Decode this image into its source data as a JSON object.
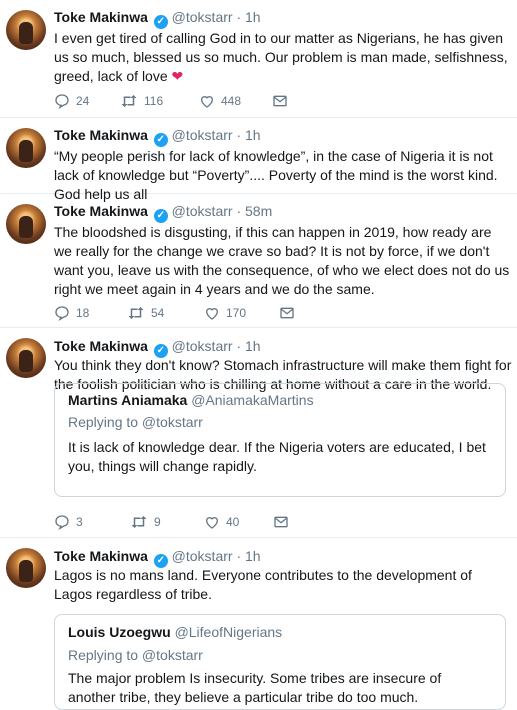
{
  "colors": {
    "accent": "#1da1f2",
    "muted": "#657786",
    "text": "#14171a",
    "border": "#e6ecf0",
    "heart": "#e0245e"
  },
  "tweets": [
    {
      "name": "Toke Makinwa",
      "handle": "@tokstarr",
      "sep": "·",
      "time": "1h",
      "text": "I even get tired of calling God in to our matter as Nigerians, he has given us so much, blessed us so much. Our problem is man made, selfishness, greed, lack of love",
      "emoji": "❤",
      "replies": "24",
      "retweets": "116",
      "likes": "448"
    },
    {
      "name": "Toke Makinwa",
      "handle": "@tokstarr",
      "sep": "·",
      "time": "1h",
      "text": "“My people perish for lack of knowledge”, in the case of Nigeria it is not lack of knowledge but “Poverty”.... Poverty of the mind is the worst kind. God help us all"
    },
    {
      "name": "Toke Makinwa",
      "handle": "@tokstarr",
      "sep": "·",
      "time": "58m",
      "text": "The bloodshed is disgusting, if this can happen in 2019, how ready are we really for the change we crave so bad? It is not by force, if we don't want you, leave us with the consequence, of who we elect does not do us right we meet again in 4 years and we do the same.",
      "replies": "18",
      "retweets": "54",
      "likes": "170"
    },
    {
      "name": "Toke Makinwa",
      "handle": "@tokstarr",
      "sep": "·",
      "time": "1h",
      "text": "You think they don't know? Stomach infrastructure will make them fight for the foolish politician who is chilling at home without a care in the world.",
      "quote": {
        "name": "Martins Aniamaka",
        "handle": "@AniamakaMartins",
        "replying": "Replying to @tokstarr",
        "text": "It is lack of knowledge dear. If the Nigeria voters are educated, I bet you, things will change rapidly."
      },
      "replies": "3",
      "retweets": "9",
      "likes": "40"
    },
    {
      "name": "Toke Makinwa",
      "handle": "@tokstarr",
      "sep": "·",
      "time": "1h",
      "text": "Lagos is no mans land. Everyone contributes to the development of Lagos regardless of tribe.",
      "quote": {
        "name": "Louis Uzoegwu",
        "handle": "@LifeofNigerians",
        "replying": "Replying to @tokstarr",
        "text": "The major problem Is insecurity. Some tribes are insecure of another tribe, they believe a particular tribe do too much."
      }
    }
  ]
}
